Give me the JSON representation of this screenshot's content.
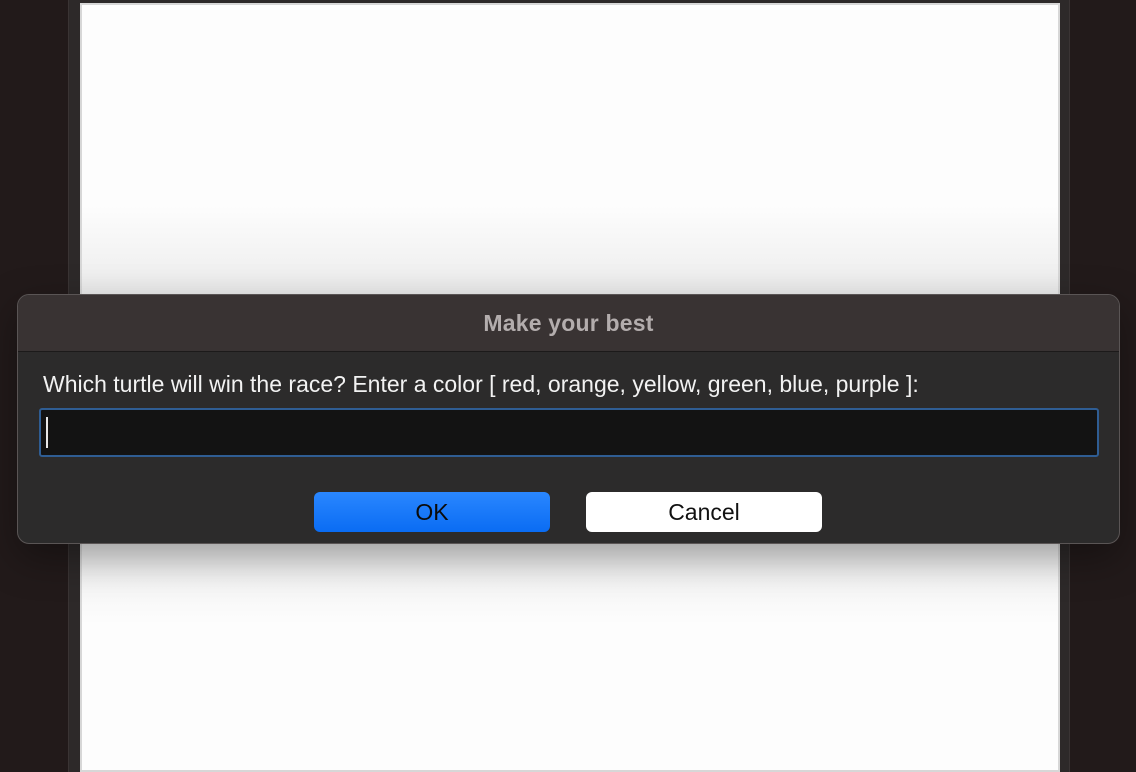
{
  "dialog": {
    "title": "Make your best",
    "prompt": "Which turtle will win the race? Enter a color [ red, orange, yellow, green, blue, purple ]:",
    "input_value": "",
    "ok_label": "OK",
    "cancel_label": "Cancel"
  },
  "colors": {
    "accent": "#0a6cf3",
    "input_focus_border": "#2f5d93",
    "dialog_background": "#2c2b2b",
    "canvas_background": "#fdfdfd"
  }
}
